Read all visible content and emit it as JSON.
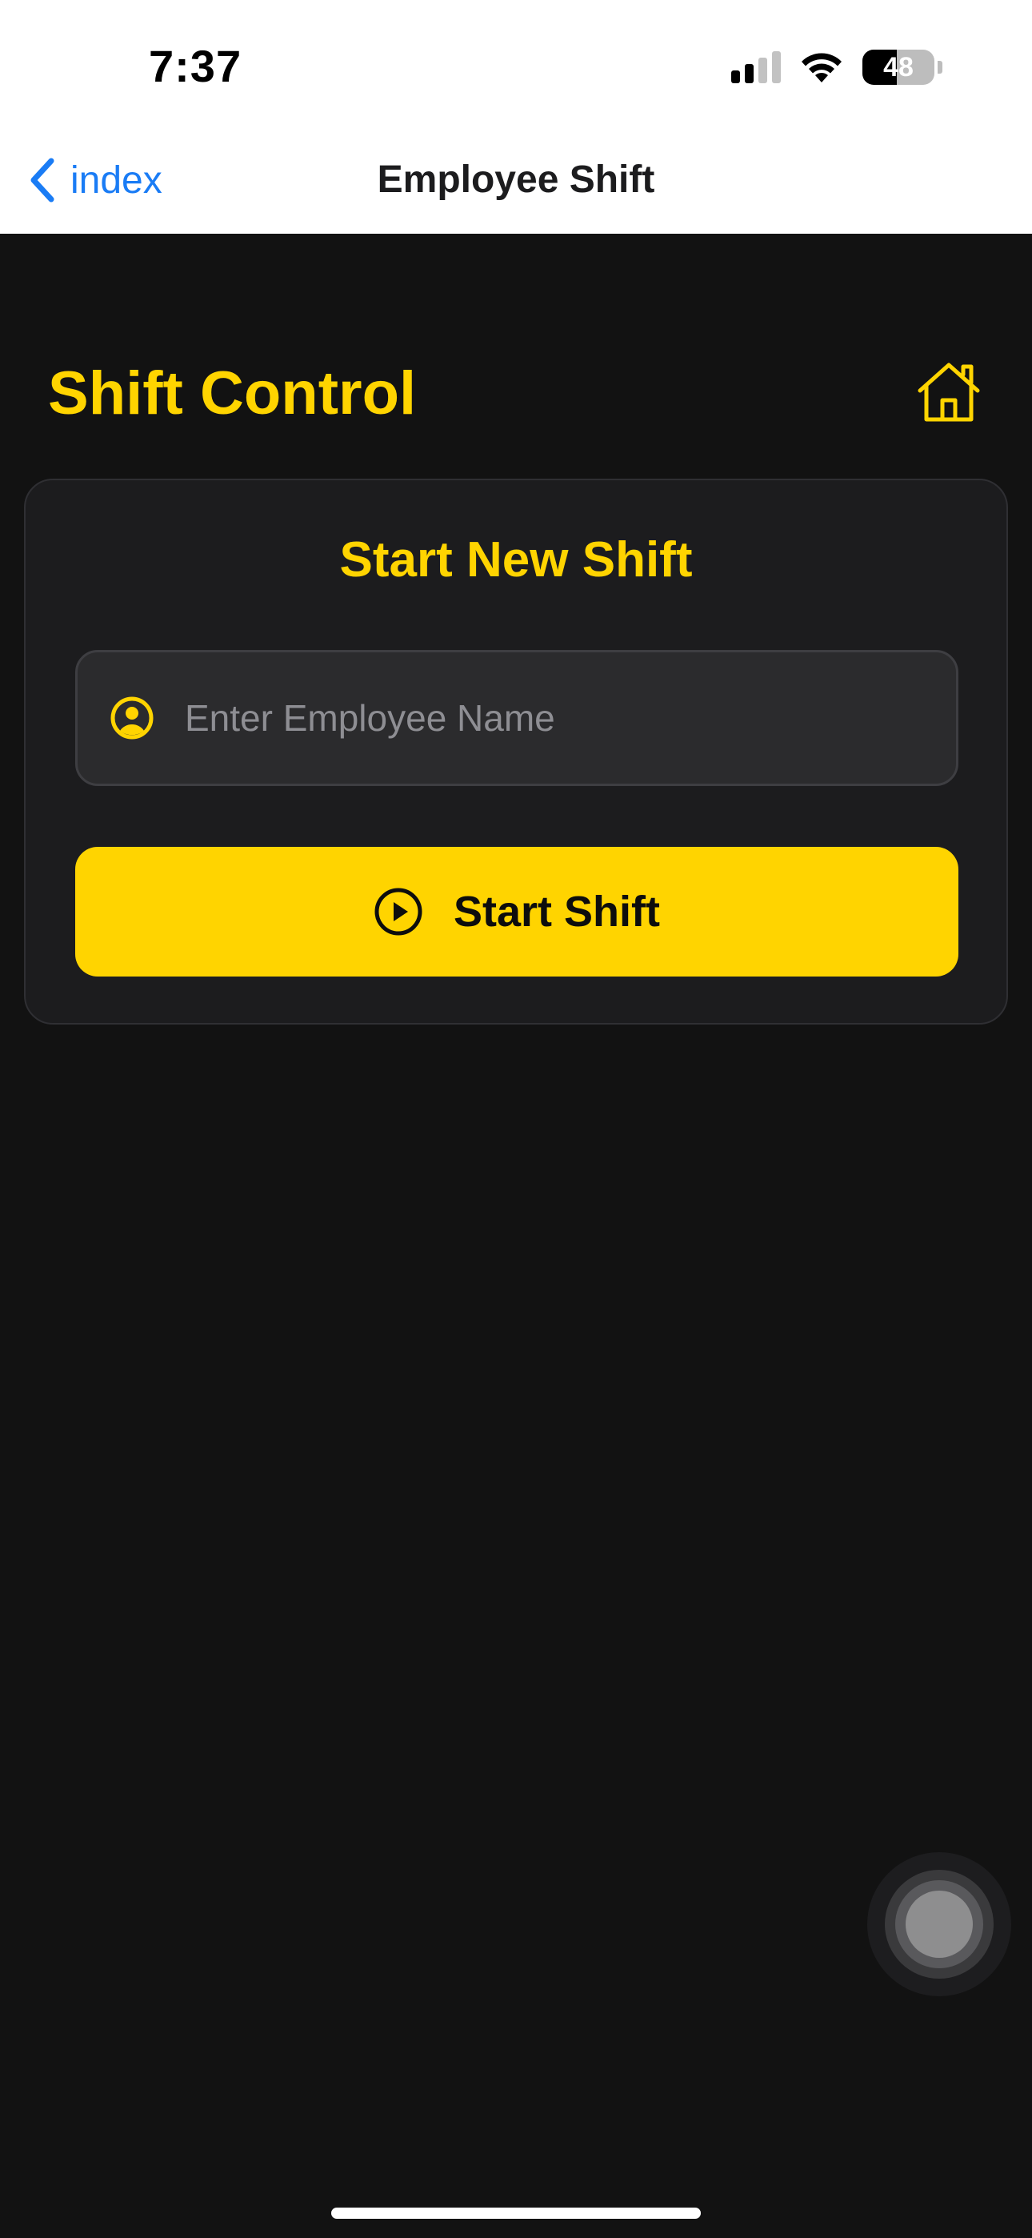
{
  "status_bar": {
    "time": "7:37",
    "battery_level": "48",
    "battery_fraction": 0.48,
    "signal_bars_active": 2,
    "signal_bars_total": 4
  },
  "nav": {
    "back_label": "index",
    "title": "Employee Shift"
  },
  "page": {
    "title": "Shift Control"
  },
  "card": {
    "title": "Start New Shift",
    "name_input": {
      "value": "",
      "placeholder": "Enter Employee Name"
    },
    "start_button_label": "Start Shift"
  },
  "icons": {
    "back": "chevron-left-icon",
    "home": "house-icon",
    "user": "user-circle-icon",
    "play": "play-circle-icon",
    "wifi": "wifi-icon",
    "signal": "cellular-signal-icon",
    "battery": "battery-icon"
  },
  "colors": {
    "background": "#121212",
    "accent": "#ffd400",
    "card": "#1c1c1e",
    "ios_blue": "#1a7cf5"
  }
}
